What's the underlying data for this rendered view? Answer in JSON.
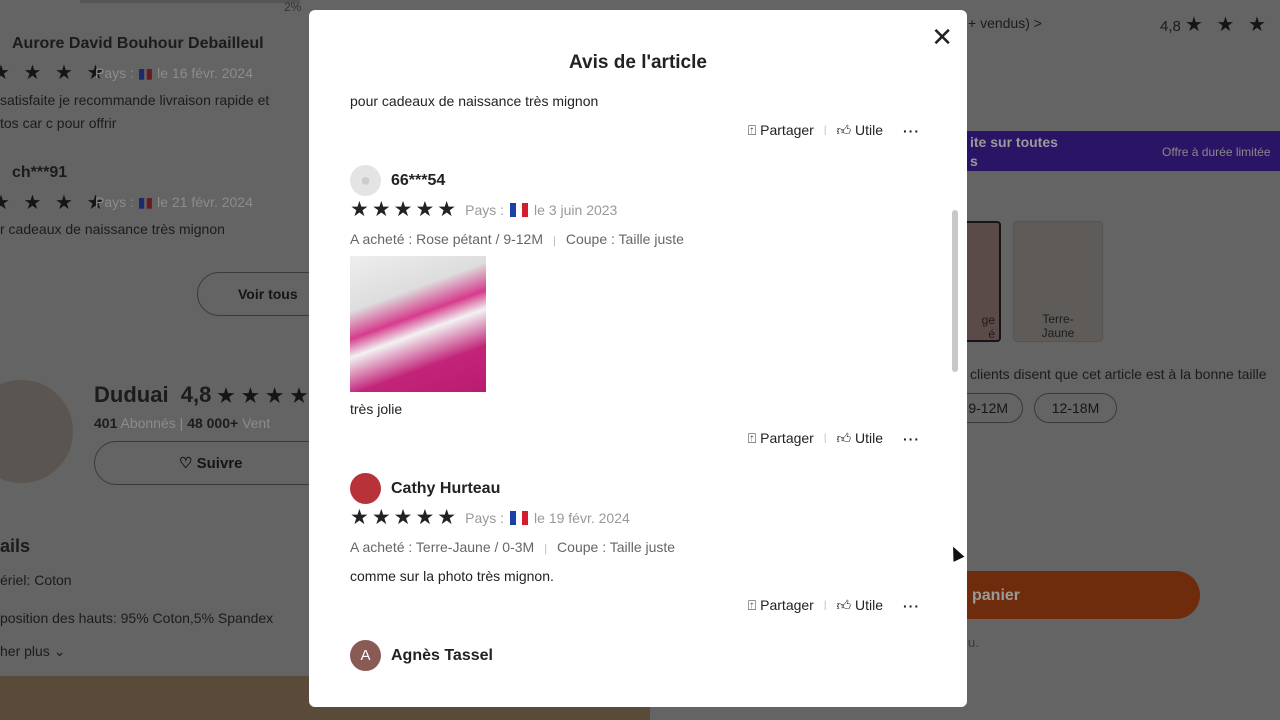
{
  "background": {
    "top_percent": "2%",
    "reviews": [
      {
        "name": "Aurore David Bouhour Debailleul",
        "stars": "★ ★ ★ ★",
        "country": "Pays :",
        "date": "le 16 févr. 2024",
        "text1": "satisfaite je recommande livraison rapide et",
        "text2": "tos car c pour offrir"
      },
      {
        "name": "ch***91",
        "stars": "★ ★ ★ ★",
        "country": "Pays :",
        "date": "le 21 févr. 2024",
        "text1": "r cadeaux de naissance très mignon"
      }
    ],
    "see_all": "Voir tous",
    "shop": {
      "name": "Duduai",
      "rating": "4,8",
      "stars": "★ ★ ★ ★",
      "followers_count": "401",
      "followers_label": "Abonnés",
      "sales_count": "48 000+",
      "sales_label": "Vent",
      "follow": "Suivre"
    },
    "details": {
      "title": "ails",
      "material": "ériel: Coton",
      "composition": "position des hauts: 95% Coton,5% Spandex",
      "more": "her plus"
    },
    "right": {
      "sold": "+ vendus) >",
      "rating": "4,8",
      "stars": "★ ★ ★ ★ ★",
      "promo1": "ite sur toutes",
      "promo2": "s",
      "promo_limited": "Offre à durée limitée",
      "variant1": "ge\né",
      "variant2": "Terre-\nJaune",
      "fit_text": "clients disent que cet article est à la bonne taille",
      "size1": "9-12M",
      "size2": "12-18M",
      "cart": "panier",
      "note": "u."
    }
  },
  "modal": {
    "title": "Avis de l'article",
    "close_icon": "close-icon",
    "actions": {
      "share": "Partager",
      "useful": "Utile",
      "more": "···"
    },
    "top_text": "pour cadeaux de naissance très mignon",
    "reviews": [
      {
        "name": "66***54",
        "stars": "★★★★★",
        "country": "Pays :",
        "date": "le 3 juin 2023",
        "bought": "A acheté : Rose pétant / 9-12M",
        "fit": "Coupe : Taille juste",
        "text": "très jolie",
        "has_photo": true
      },
      {
        "name": "Cathy Hurteau",
        "stars": "★★★★★",
        "country": "Pays :",
        "date": "le 19 févr. 2024",
        "bought": "A acheté : Terre-Jaune / 0-3M",
        "fit": "Coupe : Taille juste",
        "text": "comme sur la photo très mignon."
      },
      {
        "name": "Agnès Tassel",
        "avatar_letter": "A"
      }
    ]
  },
  "colors": {
    "promo": "#5b2bd6",
    "cart": "#f26b1d",
    "flag_blue": "#1d3fa8",
    "flag_red": "#d41c2c"
  }
}
